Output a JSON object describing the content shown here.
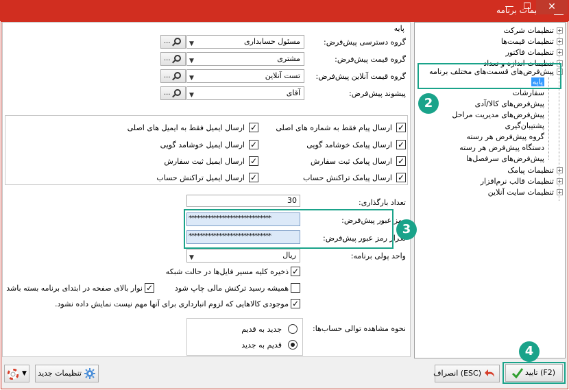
{
  "window": {
    "title": "تنظیمات برنامه",
    "close_label": "✕",
    "max_label": "☐",
    "min_label": "—"
  },
  "tree": {
    "items": [
      {
        "label": "تنظیمات شرکت",
        "expander": "+"
      },
      {
        "label": "تنظیمات قیمت‌ها",
        "expander": "+"
      },
      {
        "label": "تنظیمات فاکتور",
        "expander": "+"
      },
      {
        "label": "تنظیمات اندازه و تعداد",
        "expander": "+"
      },
      {
        "label": "پیش‌فرض‌های قسمت‌های مختلف برنامه",
        "expander": "−"
      },
      {
        "label": "پایه"
      },
      {
        "label": "سفارشات"
      },
      {
        "label": "پیش‌فرض‌های کالا/آدی"
      },
      {
        "label": "پیش‌فرض‌های مدیریت مراحل"
      },
      {
        "label": "پشتیبان‌گیری"
      },
      {
        "label": "گروه پیش‌فرض هر رسته"
      },
      {
        "label": "دستگاه پیش‌فرض هر رسته"
      },
      {
        "label": "پیش‌فرض‌های سرفصل‌ها"
      },
      {
        "label": "تنظیمات پیامک",
        "expander": "+"
      },
      {
        "label": "تنظیمات قالب نرم‌افزار",
        "expander": "+"
      },
      {
        "label": "تنظیمات سایت آنلاین",
        "expander": "+"
      }
    ]
  },
  "badges": {
    "b2": "2",
    "b3": "3",
    "b4": "4"
  },
  "main": {
    "section_title": "پایه",
    "fields": [
      {
        "label": "گروه دسترسی پیش‌فرض:",
        "value": "مسئول حسابداری",
        "more": "..."
      },
      {
        "label": "گروه قیمت پیش‌فرض:",
        "value": "مشتری",
        "more": "..."
      },
      {
        "label": "گروه قیمت آنلاین پیش‌فرض:",
        "value": "تست آنلاین",
        "more": "..."
      },
      {
        "label": "پیشوند پیش‌فرض:",
        "value": "آقای",
        "more": "..."
      }
    ],
    "checks": [
      {
        "label": "ارسال پیام فقط به شماره های اصلی",
        "checked": true
      },
      {
        "label": "ارسال ایمیل فقط به ایمیل های اصلی",
        "checked": true
      },
      {
        "label": "ارسال پیامک خوشامد گویی",
        "checked": true
      },
      {
        "label": "ارسال ایمیل خوشامد گویی",
        "checked": true
      },
      {
        "label": "ارسال پیامک ثبت سفارش",
        "checked": true
      },
      {
        "label": "ارسال ایمیل ثبت سفارش",
        "checked": true
      },
      {
        "label": "ارسال پیامک تراکنش حساب",
        "checked": true
      },
      {
        "label": "ارسال ایمیل تراکنش حساب",
        "checked": true
      }
    ],
    "load_count_label": "تعداد بارگذاری:",
    "load_count": "30",
    "password_label": "رمز عبور پیش‌فرض:",
    "password_value": "******************************",
    "password_repeat_label": "تکرار رمز عبور پیش‌فرض:",
    "password_repeat_value": "******************************",
    "currency_label": "واحد پولی برنامه:",
    "currency_value": "ریال",
    "options": [
      {
        "label": "ذخیره کلیه مسیر فایل‌ها در حالت شبکه",
        "checked": true
      },
      {
        "label": "همیشه رسید ترکنش مالی چاپ شود",
        "checked": false
      },
      {
        "label": "نوار بالای صفحه در ابتدای برنامه بسته باشد",
        "checked": true
      },
      {
        "label": "موجودی کالاهایی که لزوم انبارداری برای آنها مهم نیست نمایش داده نشود.",
        "checked": true
      }
    ],
    "order_label": "نحوه مشاهده توالی حساب‌ها:",
    "order_options": [
      {
        "label": "جدید به قدیم",
        "selected": false
      },
      {
        "label": "قدیم به جدید",
        "selected": true
      }
    ]
  },
  "footer": {
    "ok_label": "(F2) تایید",
    "cancel_label": "(ESC) انصراف",
    "new_settings_label": "تنظیمات جدید"
  }
}
